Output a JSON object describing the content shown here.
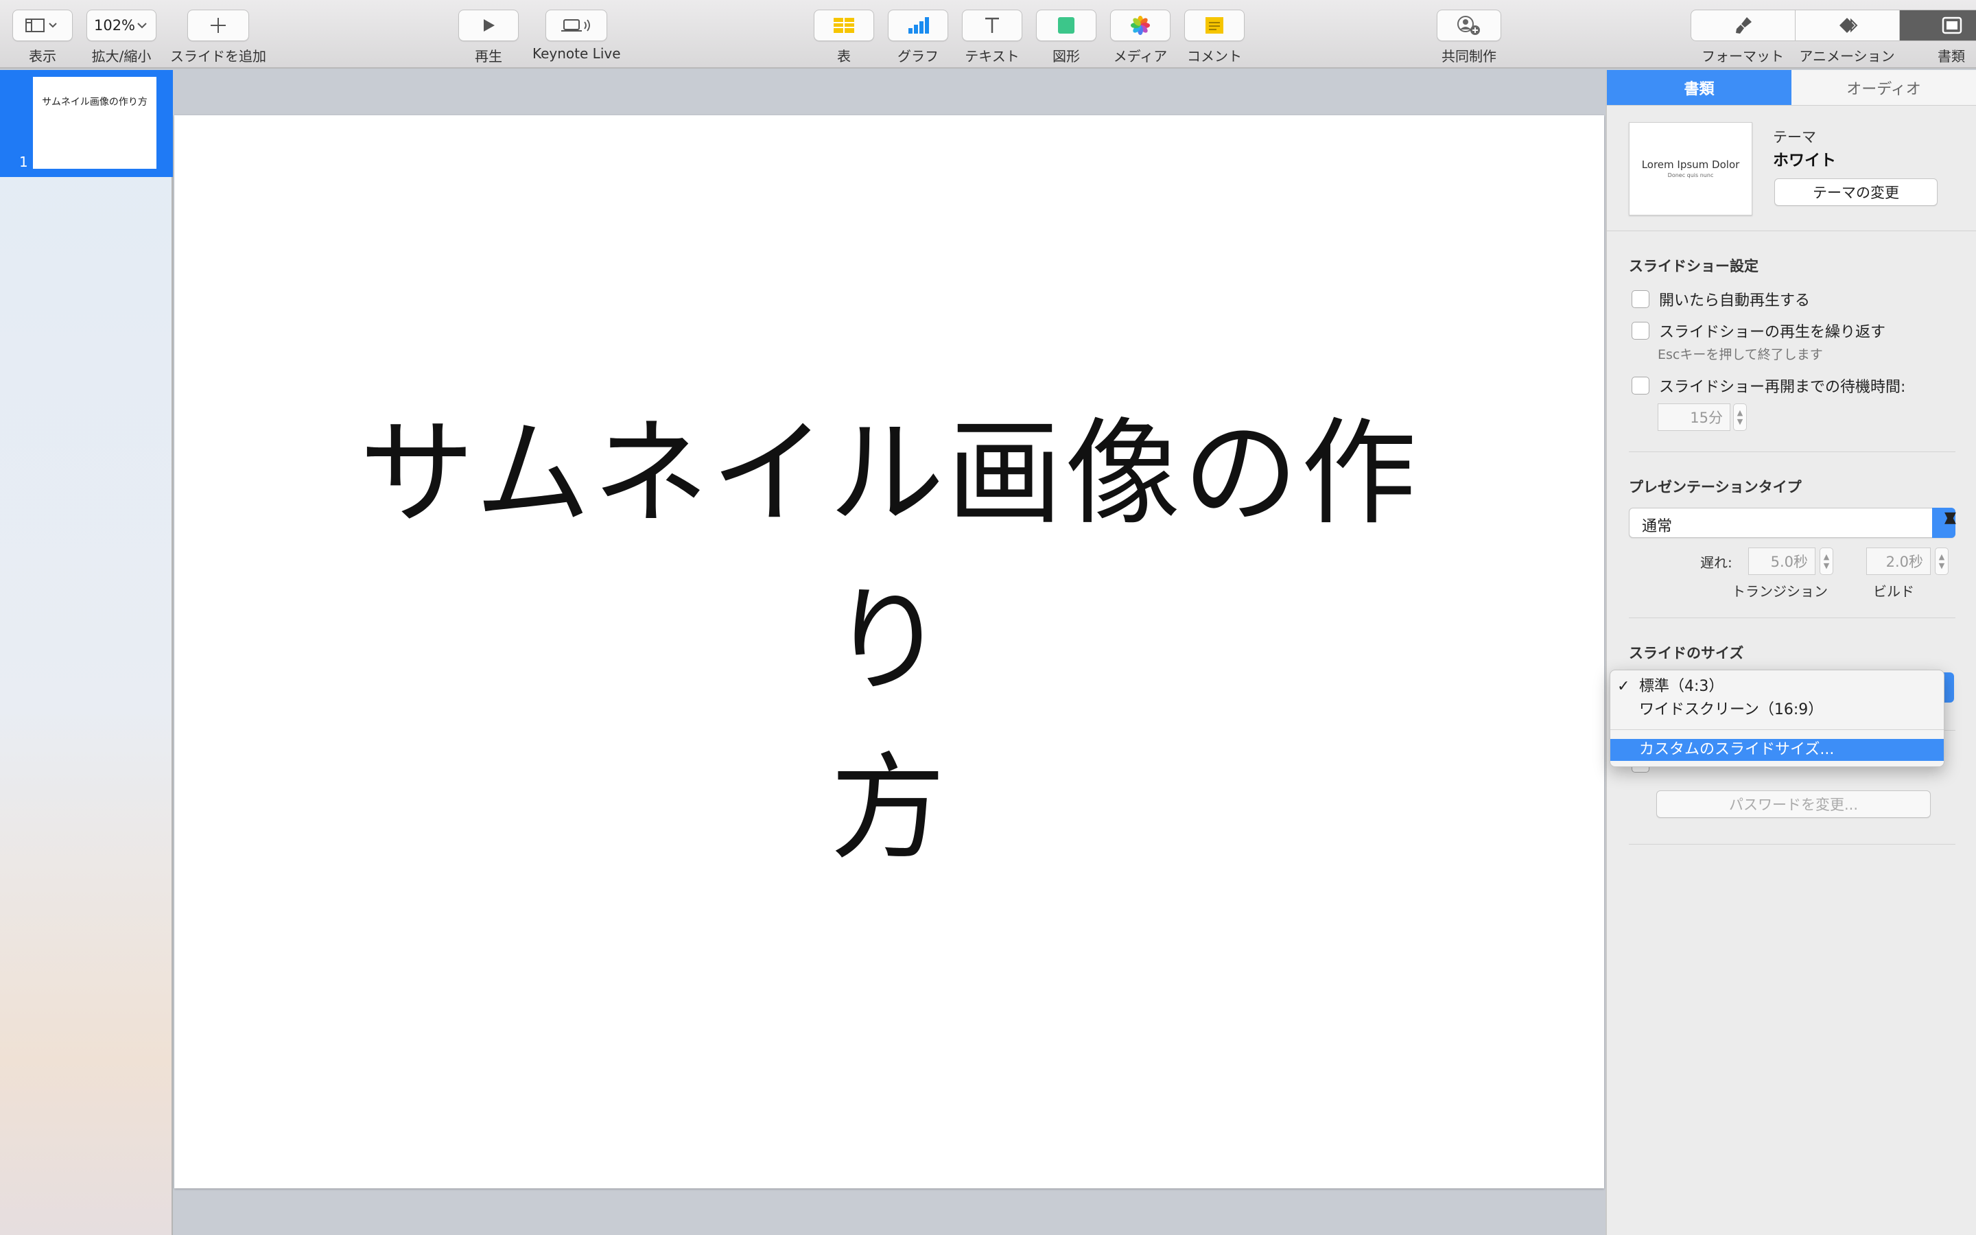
{
  "toolbar": {
    "view_label": "表示",
    "zoom_value": "102%",
    "zoom_label": "拡大/縮小",
    "add_slide_label": "スライドを追加",
    "play_label": "再生",
    "keynote_live_label": "Keynote Live",
    "table_label": "表",
    "chart_label": "グラフ",
    "text_label": "テキスト",
    "shape_label": "図形",
    "media_label": "メディア",
    "comment_label": "コメント",
    "collaborate_label": "共同制作",
    "format_label": "フォーマット",
    "animate_label": "アニメーション",
    "document_label": "書類"
  },
  "navigator": {
    "slide_number": "1",
    "thumb_text": "サムネイル画像の作り方"
  },
  "slide": {
    "title_line1": "サムネイル画像の作り",
    "title_line2": "方"
  },
  "inspector": {
    "tab_document": "書類",
    "tab_audio": "オーディオ",
    "theme_preview_title": "Lorem Ipsum Dolor",
    "theme_preview_sub": "Donec quis nunc",
    "theme_label": "テーマ",
    "theme_name": "ホワイト",
    "change_theme": "テーマの変更",
    "slideshow_settings": "スライドショー設定",
    "autoplay": "開いたら自動再生する",
    "loop": "スライドショーの再生を繰り返す",
    "loop_note": "Escキーを押して終了します",
    "restart_wait": "スライドショー再開までの待機時間:",
    "wait_value": "15分",
    "presentation_type": "プレゼンテーションタイプ",
    "presentation_value": "通常",
    "delay_label": "遅れ:",
    "transition_value": "5.0秒",
    "build_value": "2.0秒",
    "transition_label": "トランジション",
    "build_label": "ビルド",
    "slide_size": "スライドのサイズ",
    "change_password": "パスワードを変更..."
  },
  "menu": {
    "standard": "標準（4:3）",
    "widescreen": "ワイドスクリーン（16:9）",
    "custom": "カスタムのスライドサイズ..."
  },
  "colors": {
    "accent": "#3d8ef7",
    "selection": "#1f7af5"
  }
}
